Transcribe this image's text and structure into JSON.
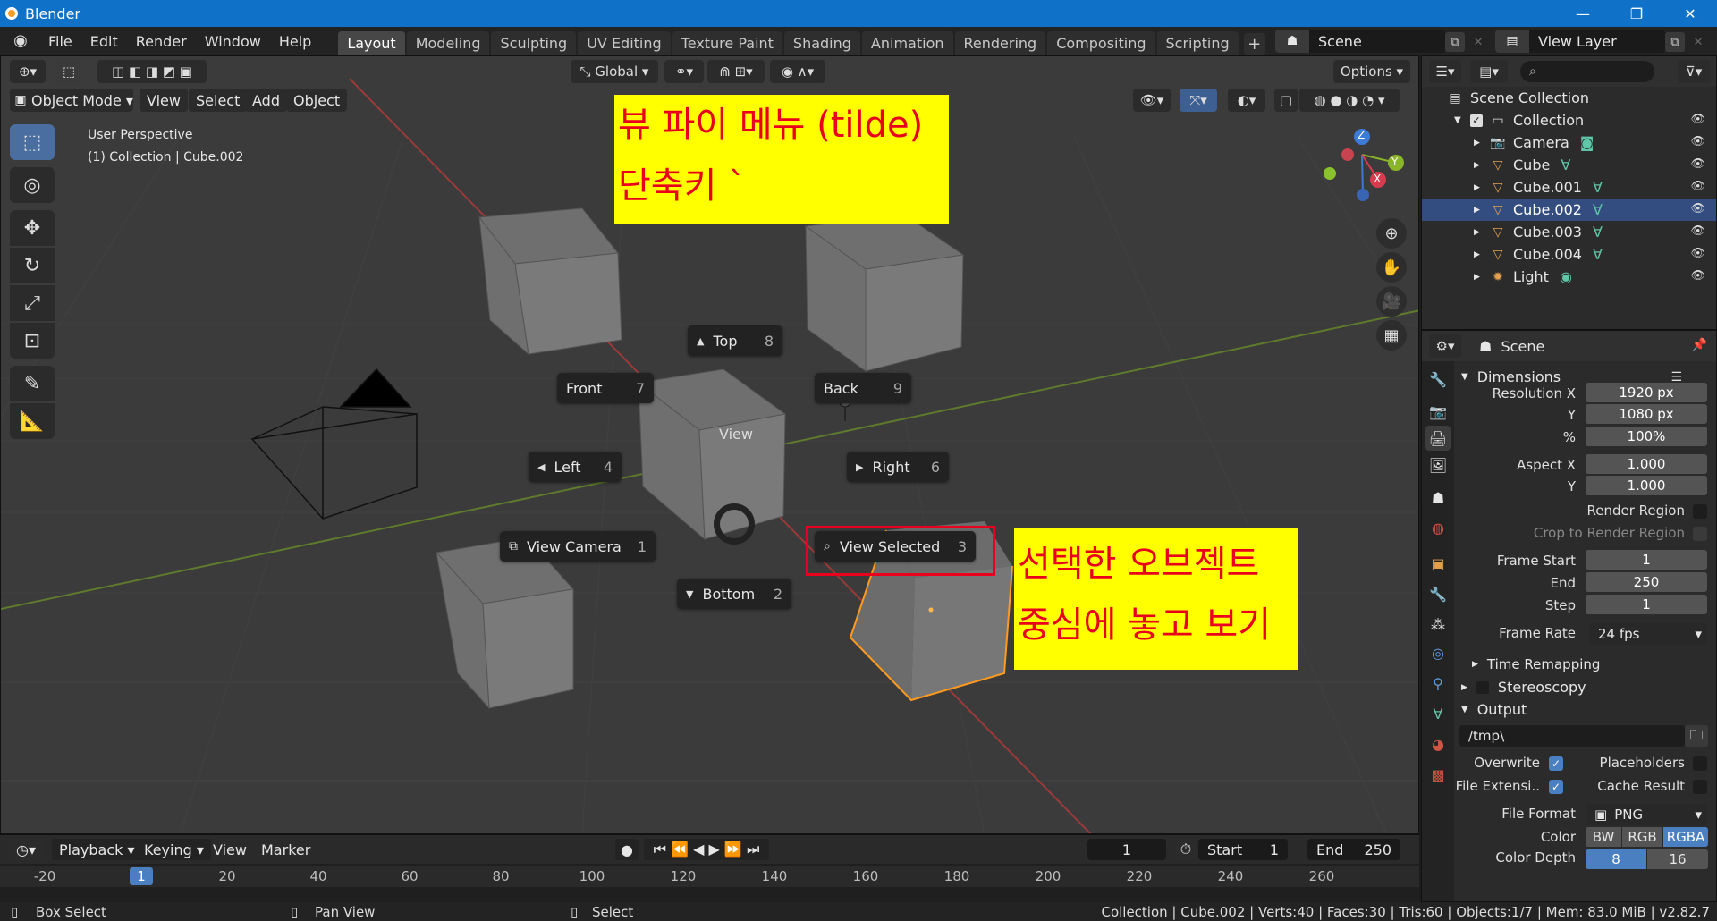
{
  "window": {
    "title": "Blender",
    "controls": [
      "—",
      "❐",
      "✕"
    ]
  },
  "topbar": {
    "menus": [
      "File",
      "Edit",
      "Render",
      "Window",
      "Help"
    ],
    "workspaces": [
      "Layout",
      "Modeling",
      "Sculpting",
      "UV Editing",
      "Texture Paint",
      "Shading",
      "Animation",
      "Rendering",
      "Compositing",
      "Scripting"
    ],
    "active_workspace": "Layout",
    "add_tab": "+",
    "scene": "Scene",
    "view_layer": "View Layer"
  },
  "viewport": {
    "transform_orientation": "Global",
    "options_label": "Options",
    "mode": "Object Mode",
    "menus": [
      "View",
      "Select",
      "Add",
      "Object"
    ],
    "info_line1": "User Perspective",
    "info_line2": "(1) Collection | Cube.002",
    "gizmo_labels": {
      "z": "Z",
      "y": "Y",
      "x": "X"
    }
  },
  "pie_menu": {
    "title": "View",
    "items": [
      {
        "label": "Top",
        "key": "8"
      },
      {
        "label": "Front",
        "key": "7"
      },
      {
        "label": "Back",
        "key": "9"
      },
      {
        "label": "Left",
        "key": "4"
      },
      {
        "label": "Right",
        "key": "6"
      },
      {
        "label": "View Camera",
        "key": "1"
      },
      {
        "label": "View Selected",
        "key": "3"
      },
      {
        "label": "Bottom",
        "key": "2"
      }
    ]
  },
  "annotations": {
    "top_line1": "뷰 파이 메뉴 (tilde)",
    "top_line2": "단축키 `",
    "right_line1": "선택한 오브젝트",
    "right_line2": "중심에 놓고 보기",
    "highlight_color": "#ffff00",
    "text_color": "#e8001c"
  },
  "timeline": {
    "menus": [
      "Playback",
      "Keying",
      "View",
      "Marker"
    ],
    "current_frame": "1",
    "start_label": "Start",
    "start": "1",
    "end_label": "End",
    "end": "250",
    "ticks": [
      "-20",
      "1",
      "20",
      "40",
      "60",
      "80",
      "100",
      "120",
      "140",
      "160",
      "180",
      "200",
      "220",
      "240",
      "260"
    ]
  },
  "statusbar": {
    "left1": "Box Select",
    "left2": "Pan View",
    "left3": "Select",
    "right": "Collection | Cube.002 | Verts:40 | Faces:30 | Tris:60 | Objects:1/7 | Mem: 83.0 MiB | v2.82.7"
  },
  "outliner": {
    "search_placeholder": "",
    "root": "Scene Collection",
    "collection": "Collection",
    "items": [
      "Camera",
      "Cube",
      "Cube.001",
      "Cube.002",
      "Cube.003",
      "Cube.004",
      "Light"
    ],
    "selected": "Cube.002"
  },
  "properties": {
    "context": "Scene",
    "dimensions_title": "Dimensions",
    "res_x_label": "Resolution X",
    "res_x": "1920 px",
    "res_y_label": "Y",
    "res_y": "1080 px",
    "pct_label": "%",
    "pct": "100%",
    "aspect_x_label": "Aspect X",
    "aspect_x": "1.000",
    "aspect_y_label": "Y",
    "aspect_y": "1.000",
    "render_region": "Render Region",
    "crop_region": "Crop to Render Region",
    "frame_start_label": "Frame Start",
    "frame_start": "1",
    "end_label": "End",
    "end": "250",
    "step_label": "Step",
    "step": "1",
    "frame_rate_label": "Frame Rate",
    "frame_rate": "24 fps",
    "time_remapping": "Time Remapping",
    "stereoscopy": "Stereoscopy",
    "output_title": "Output",
    "output_path": "/tmp\\",
    "overwrite": "Overwrite",
    "placeholders": "Placeholders",
    "file_ext": "File Extensi..",
    "cache_result": "Cache Result",
    "file_format_label": "File Format",
    "file_format": "PNG",
    "color_label": "Color",
    "color_modes": [
      "BW",
      "RGB",
      "RGBA"
    ],
    "color_depth_label": "Color Depth",
    "color_depth": [
      "8",
      "16"
    ]
  }
}
